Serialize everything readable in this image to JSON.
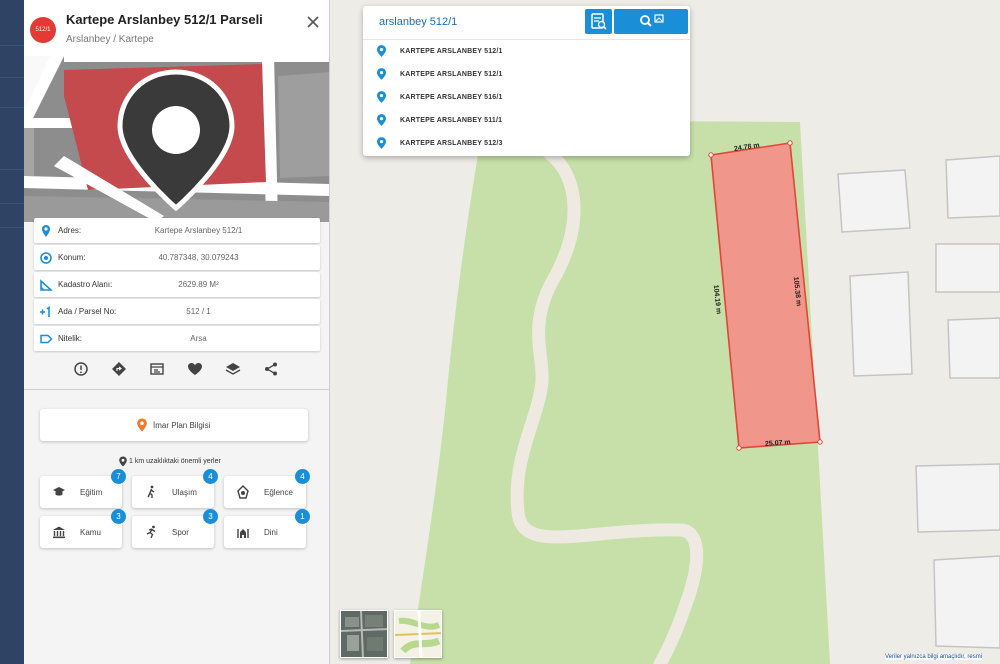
{
  "panel": {
    "badge": "512/1",
    "title": "Kartepe Arslanbey 512/1 Parseli",
    "subtitle": "Arslanbey / Kartepe",
    "info": [
      {
        "icon": "location-pin-icon",
        "label": "Adres:",
        "value": "Kartepe Arslanbey 512/1"
      },
      {
        "icon": "target-icon",
        "label": "Konum:",
        "value": "40.787348, 30.079243"
      },
      {
        "icon": "area-icon",
        "label": "Kadastro Alanı:",
        "value": "2629.89 M²"
      },
      {
        "icon": "plus-one-icon",
        "label": "Ada / Parsel No:",
        "value": "512 / 1"
      },
      {
        "icon": "tag-icon",
        "label": "Nitelik:",
        "value": "Arsa"
      }
    ],
    "imar_button": "İmar Plan Bilgisi",
    "nearby_title": "1 km uzaklıktaki önemli yerler",
    "categories": [
      {
        "icon": "graduation-cap-icon",
        "label": "Eğitim",
        "count": "7"
      },
      {
        "icon": "walking-icon",
        "label": "Ulaşım",
        "count": "4"
      },
      {
        "icon": "entertainment-icon",
        "label": "Eğlence",
        "count": "4"
      },
      {
        "icon": "government-icon",
        "label": "Kamu",
        "count": "3"
      },
      {
        "icon": "running-icon",
        "label": "Spor",
        "count": "3"
      },
      {
        "icon": "mosque-icon",
        "label": "Dini",
        "count": "1"
      }
    ]
  },
  "search": {
    "value": "arslanbey 512/1",
    "suggestions": [
      "KARTEPE ARSLANBEY 512/1",
      "KARTEPE ARSLANBEY 512/1",
      "KARTEPE ARSLANBEY 516/1",
      "KARTEPE ARSLANBEY 511/1",
      "KARTEPE ARSLANBEY 512/3"
    ]
  },
  "parcel": {
    "top_length": "24.78 m",
    "left_length": "104.19 m",
    "right_length": "105.38 m",
    "bottom_length": "25.07 m"
  },
  "attribution": "Veriler yalnızca bilgi amaçlıdır, resmi",
  "colors": {
    "accent": "#1a8fd8",
    "badge": "#e53935",
    "parcel_fill": "#f0968a",
    "parcel_stroke": "#e0463a",
    "park": "#c7dfa8",
    "nav": "#2f4365"
  }
}
